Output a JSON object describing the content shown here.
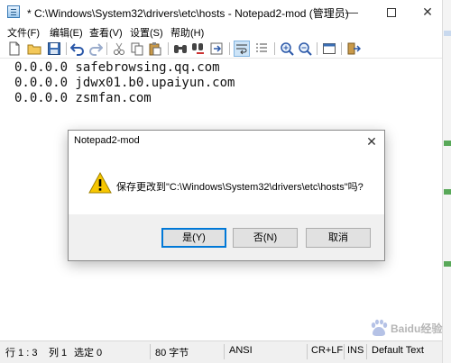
{
  "window": {
    "title": "* C:\\Windows\\System32\\drivers\\etc\\hosts - Notepad2-mod (管理员)",
    "min_icon": "minimize-icon",
    "max_icon": "maximize-icon",
    "close_icon": "close-icon",
    "close_glyph": "✕",
    "min_glyph": "—"
  },
  "menu": [
    {
      "label": "文件(F)"
    },
    {
      "label": "编辑(E)"
    },
    {
      "label": "查看(V)"
    },
    {
      "label": "设置(S)"
    },
    {
      "label": "帮助(H)"
    }
  ],
  "toolbar": [
    {
      "icon": "new-file-icon"
    },
    {
      "icon": "open-folder-icon"
    },
    {
      "icon": "save-icon"
    },
    {
      "icon": "undo-icon"
    },
    {
      "icon": "redo-icon"
    },
    {
      "icon": "cut-icon"
    },
    {
      "icon": "copy-icon"
    },
    {
      "icon": "paste-icon"
    },
    {
      "icon": "find-icon"
    },
    {
      "icon": "replace-icon"
    },
    {
      "icon": "goto-icon"
    },
    {
      "icon": "word-wrap-icon"
    },
    {
      "icon": "line-numbers-icon"
    },
    {
      "icon": "zoom-in-icon"
    },
    {
      "icon": "zoom-out-icon"
    },
    {
      "icon": "scheme-icon"
    },
    {
      "icon": "exit-icon"
    }
  ],
  "editor": {
    "lines": [
      "0.0.0.0 safebrowsing.qq.com",
      "0.0.0.0 jdwx01.b0.upaiyun.com",
      "0.0.0.0 zsmfan.com"
    ]
  },
  "dialog": {
    "title": "Notepad2-mod",
    "close_glyph": "✕",
    "icon": "warning-icon",
    "message": "保存更改到\"C:\\Windows\\System32\\drivers\\etc\\hosts\"吗?",
    "buttons": {
      "yes": "是(Y)",
      "no": "否(N)",
      "cancel": "取消"
    }
  },
  "statusbar": {
    "position": "行 1 : 3",
    "column": "列 1",
    "selection": "选定 0",
    "size": "80 字节",
    "encoding": "ANSI",
    "line_ending": "CR+LF",
    "insert_mode": "INS",
    "scheme": "Default Text"
  },
  "watermark": {
    "text": "Baidu经验",
    "icon": "baidu-paw-icon"
  }
}
